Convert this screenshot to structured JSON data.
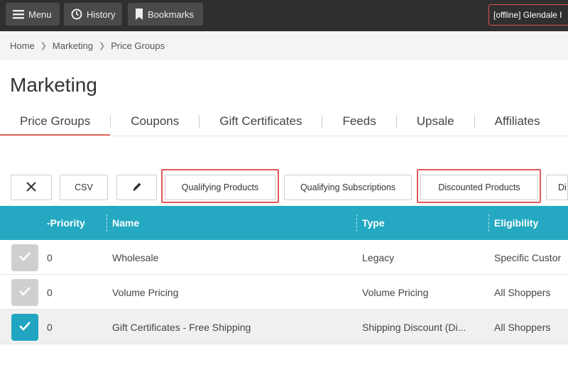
{
  "topbar": {
    "menu_label": "Menu",
    "history_label": "History",
    "bookmarks_label": "Bookmarks",
    "store_label": "[offline] Glendale I"
  },
  "breadcrumb": [
    "Home",
    "Marketing",
    "Price Groups"
  ],
  "page": {
    "title": "Marketing"
  },
  "tabs": [
    {
      "label": "Price Groups",
      "active": true
    },
    {
      "label": "Coupons"
    },
    {
      "label": "Gift Certificates"
    },
    {
      "label": "Feeds"
    },
    {
      "label": "Upsale"
    },
    {
      "label": "Affiliates"
    }
  ],
  "toolbar": {
    "csv_label": "CSV",
    "qualifying_products_label": "Qualifying Products",
    "qualifying_subscriptions_label": "Qualifying Subscriptions",
    "discounted_products_label": "Discounted Products",
    "cut_label": "Di"
  },
  "table": {
    "columns": [
      "-Priority",
      "Name",
      "Type",
      "Eligibility"
    ],
    "rows": [
      {
        "priority": "0",
        "name": "Wholesale",
        "type": "Legacy",
        "eligibility": "Specific Custor",
        "checked": false
      },
      {
        "priority": "0",
        "name": "Volume Pricing",
        "type": "Volume Pricing",
        "eligibility": "All Shoppers",
        "checked": false
      },
      {
        "priority": "0",
        "name": "Gift Certificates - Free Shipping",
        "type": "Shipping Discount (Di...",
        "eligibility": "All Shoppers",
        "checked": true
      }
    ]
  },
  "colors": {
    "topbar": "#2f2f2f",
    "table_header": "#25a9c2",
    "accent_underline": "#e8685a",
    "highlight_box": "#e05a5a",
    "checkbox_on": "#21a5c0"
  },
  "icons": [
    "hamburger-icon",
    "clock-icon",
    "bookmark-icon",
    "close-icon",
    "pencil-icon",
    "check-icon"
  ]
}
